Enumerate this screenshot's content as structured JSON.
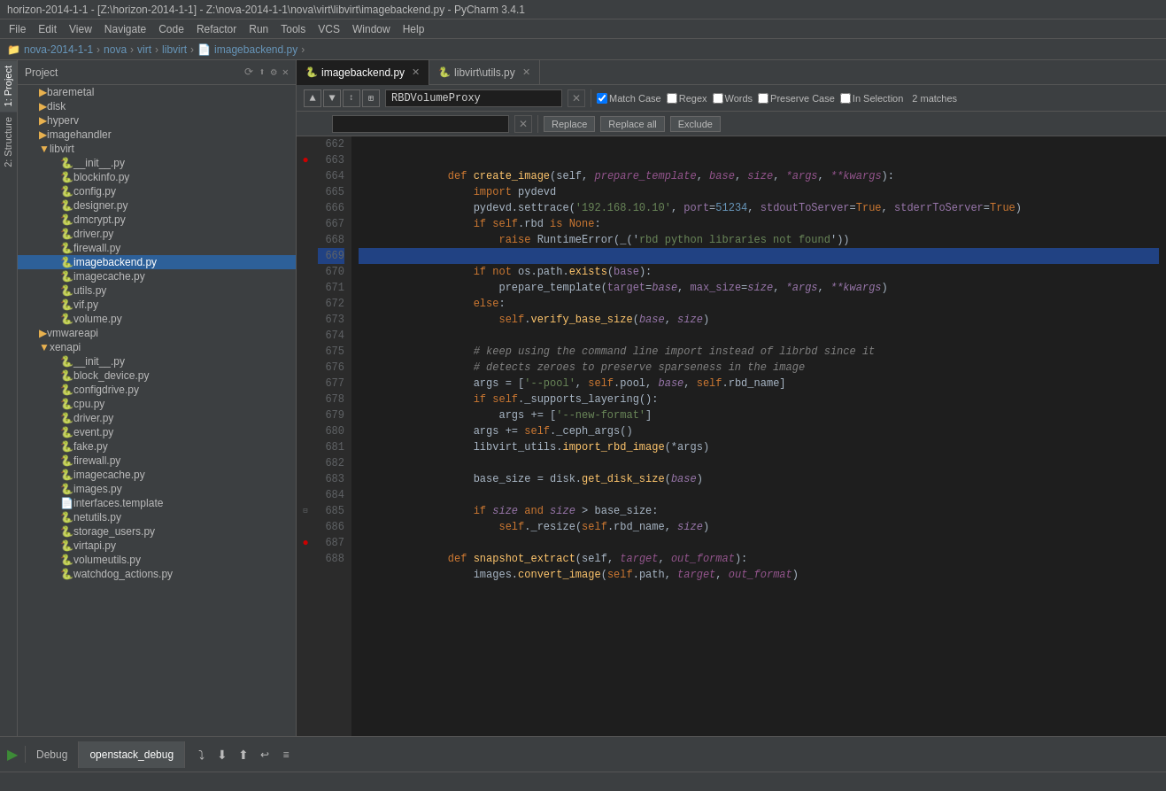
{
  "titleBar": {
    "text": "horizon-2014-1-1 - [Z:\\horizon-2014-1-1] - Z:\\nova-2014-1-1\\nova\\virt\\libvirt\\imagebackend.py - PyCharm 3.4.1"
  },
  "menu": {
    "items": [
      "File",
      "Edit",
      "View",
      "Navigate",
      "Code",
      "Refactor",
      "Run",
      "Tools",
      "VCS",
      "Window",
      "Help"
    ]
  },
  "breadcrumb": {
    "items": [
      "nova-2014-1-1",
      "nova",
      "virt",
      "libvirt",
      "imagebackend.py"
    ]
  },
  "tabs": [
    {
      "label": "imagebackend.py",
      "active": true,
      "closeable": true
    },
    {
      "label": "libvirt\\utils.py",
      "active": false,
      "closeable": true
    }
  ],
  "search": {
    "findLabel": "RBDVolumeProxy",
    "replacePlaceholder": "",
    "matchCount": "2 matches",
    "options": {
      "matchCase": {
        "label": "Match Case",
        "checked": true
      },
      "regex": {
        "label": "Regex",
        "checked": false
      },
      "words": {
        "label": "Words",
        "checked": false
      },
      "preserveCase": {
        "label": "Preserve Case",
        "checked": false
      },
      "inSelection": {
        "label": "In Selection",
        "checked": false
      }
    },
    "buttons": {
      "replace": "Replace",
      "replaceAll": "Replace all",
      "exclude": "Exclude"
    }
  },
  "project": {
    "title": "Project",
    "tree": [
      {
        "indent": 2,
        "type": "folder",
        "label": "baremetal",
        "expanded": true
      },
      {
        "indent": 2,
        "type": "folder",
        "label": "disk",
        "expanded": true
      },
      {
        "indent": 2,
        "type": "folder",
        "label": "hyperv",
        "expanded": true
      },
      {
        "indent": 2,
        "type": "folder",
        "label": "imagehandler",
        "expanded": true
      },
      {
        "indent": 2,
        "type": "folder",
        "label": "libvirt",
        "expanded": true
      },
      {
        "indent": 3,
        "type": "py",
        "label": "__init__.py"
      },
      {
        "indent": 3,
        "type": "py",
        "label": "blockinfo.py"
      },
      {
        "indent": 3,
        "type": "py",
        "label": "config.py"
      },
      {
        "indent": 3,
        "type": "py",
        "label": "designer.py"
      },
      {
        "indent": 3,
        "type": "py",
        "label": "dmcrypt.py"
      },
      {
        "indent": 3,
        "type": "py",
        "label": "driver.py"
      },
      {
        "indent": 3,
        "type": "py",
        "label": "firewall.py"
      },
      {
        "indent": 3,
        "type": "py",
        "label": "imagebackend.py",
        "selected": true
      },
      {
        "indent": 3,
        "type": "py",
        "label": "imagecache.py"
      },
      {
        "indent": 3,
        "type": "py",
        "label": "utils.py"
      },
      {
        "indent": 3,
        "type": "py",
        "label": "vif.py"
      },
      {
        "indent": 3,
        "type": "py",
        "label": "volume.py"
      },
      {
        "indent": 2,
        "type": "folder",
        "label": "vmwareapi",
        "expanded": true
      },
      {
        "indent": 2,
        "type": "folder",
        "label": "xenapi",
        "expanded": true
      },
      {
        "indent": 3,
        "type": "py",
        "label": "__init__.py"
      },
      {
        "indent": 3,
        "type": "py",
        "label": "block_device.py"
      },
      {
        "indent": 3,
        "type": "py",
        "label": "configdrive.py"
      },
      {
        "indent": 3,
        "type": "py",
        "label": "cpu.py"
      },
      {
        "indent": 3,
        "type": "py",
        "label": "driver.py"
      },
      {
        "indent": 3,
        "type": "py",
        "label": "event.py"
      },
      {
        "indent": 3,
        "type": "py",
        "label": "fake.py"
      },
      {
        "indent": 3,
        "type": "py",
        "label": "firewall.py"
      },
      {
        "indent": 3,
        "type": "py",
        "label": "imagecache.py"
      },
      {
        "indent": 3,
        "type": "py",
        "label": "images.py"
      },
      {
        "indent": 3,
        "type": "tmpl",
        "label": "interfaces.template"
      },
      {
        "indent": 3,
        "type": "py",
        "label": "netutils.py"
      },
      {
        "indent": 3,
        "type": "py",
        "label": "storage_users.py"
      },
      {
        "indent": 3,
        "type": "py",
        "label": "virtapi.py"
      },
      {
        "indent": 3,
        "type": "py",
        "label": "volumeutils.py"
      },
      {
        "indent": 3,
        "type": "py",
        "label": "watchdog_actions.py"
      }
    ]
  },
  "code": {
    "lines": [
      {
        "num": 662,
        "content": "",
        "gutter": ""
      },
      {
        "num": 663,
        "content": "    def create_image(self, prepare_template, base, size, *args, **kwargs):",
        "gutter": "bp"
      },
      {
        "num": 664,
        "content": "        import pydevd",
        "gutter": ""
      },
      {
        "num": 665,
        "content": "        pydevd.settrace('192.168.10.10', port=51234, stdoutToServer=True, stderrToServer=True)",
        "gutter": ""
      },
      {
        "num": 666,
        "content": "        if self.rbd is None:",
        "gutter": ""
      },
      {
        "num": 667,
        "content": "            raise RuntimeError(_('rbd python libraries not found'))",
        "gutter": ""
      },
      {
        "num": 668,
        "content": "",
        "gutter": ""
      },
      {
        "num": 669,
        "content": "        if not os.path.exists(base):",
        "gutter": "",
        "selected": true
      },
      {
        "num": 670,
        "content": "            prepare_template(target=base, max_size=size, *args, **kwargs)",
        "gutter": ""
      },
      {
        "num": 671,
        "content": "        else:",
        "gutter": ""
      },
      {
        "num": 672,
        "content": "            self.verify_base_size(base, size)",
        "gutter": ""
      },
      {
        "num": 673,
        "content": "",
        "gutter": ""
      },
      {
        "num": 674,
        "content": "        # keep using the command line import instead of librbd since it",
        "gutter": ""
      },
      {
        "num": 675,
        "content": "        # detects zeroes to preserve sparseness in the image",
        "gutter": ""
      },
      {
        "num": 676,
        "content": "        args = ['--pool', self.pool, base, self.rbd_name]",
        "gutter": ""
      },
      {
        "num": 677,
        "content": "        if self._supports_layering():",
        "gutter": ""
      },
      {
        "num": 678,
        "content": "            args += ['--new-format']",
        "gutter": ""
      },
      {
        "num": 679,
        "content": "        args += self._ceph_args()",
        "gutter": ""
      },
      {
        "num": 680,
        "content": "        libvirt_utils.import_rbd_image(*args)",
        "gutter": ""
      },
      {
        "num": 681,
        "content": "",
        "gutter": ""
      },
      {
        "num": 682,
        "content": "        base_size = disk.get_disk_size(base)",
        "gutter": ""
      },
      {
        "num": 683,
        "content": "",
        "gutter": ""
      },
      {
        "num": 684,
        "content": "        if size and size > base_size:",
        "gutter": ""
      },
      {
        "num": 685,
        "content": "            self._resize(self.rbd_name, size)",
        "gutter": "fold"
      },
      {
        "num": 686,
        "content": "",
        "gutter": ""
      },
      {
        "num": 687,
        "content": "    def snapshot_extract(self, target, out_format):",
        "gutter": "bp"
      },
      {
        "num": 688,
        "content": "        images.convert_image(self.path, target, out_format)",
        "gutter": ""
      }
    ]
  },
  "debugPanel": {
    "tabs": [
      "Debug",
      "openstack_debug"
    ],
    "activeTab": "Debug",
    "icons": [
      "▶",
      "⏸",
      "⏹",
      "↩",
      "↪",
      "⬇",
      "⬆"
    ]
  },
  "statusBar": {
    "text": ""
  },
  "verticalTabs": {
    "left": [
      "1: Project",
      "2: Structure"
    ]
  }
}
